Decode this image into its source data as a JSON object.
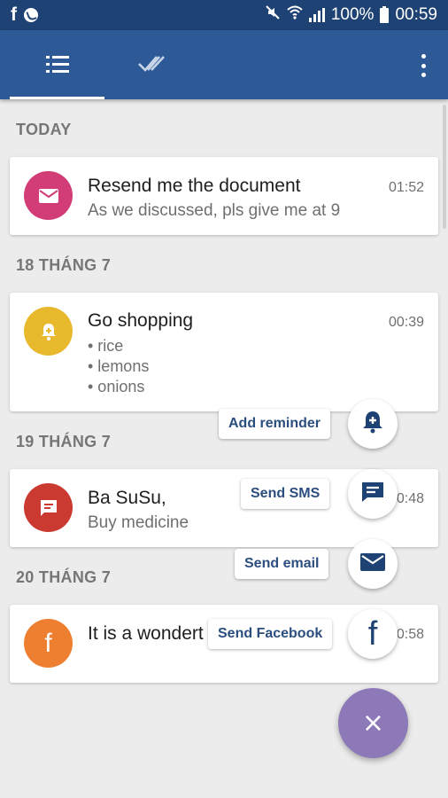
{
  "status_bar": {
    "left_icons": [
      "facebook-icon",
      "whatsapp-icon"
    ],
    "right_icons": [
      "mute-icon",
      "wifi-icon",
      "signal-icon",
      "battery-icon"
    ],
    "battery": "100%",
    "time": "00:59"
  },
  "app_bar": {
    "tabs": [
      {
        "icon": "list-icon",
        "selected": true
      },
      {
        "icon": "done-all-icon",
        "selected": false
      }
    ],
    "menu_icon": "more-vert-icon"
  },
  "sections": [
    {
      "header": "TODAY",
      "items": [
        {
          "icon": "email-icon",
          "color": "#d23c77",
          "title": "Resend me the document",
          "subtitle": "As we discussed, pls give me at 9",
          "time": "01:52"
        }
      ]
    },
    {
      "header": "18 THÁNG 7",
      "items": [
        {
          "icon": "reminder-icon",
          "color": "#e8b92d",
          "title": "Go shopping",
          "bullets": [
            "• rice",
            "• lemons",
            "• onions"
          ],
          "time": "00:39"
        }
      ]
    },
    {
      "header": "19 THÁNG 7",
      "items": [
        {
          "icon": "sms-icon",
          "color": "#cb3a30",
          "title": "Ba SuSu,",
          "subtitle": "Buy medicine",
          "time": "0:48"
        }
      ]
    },
    {
      "header": "20 THÁNG 7",
      "items": [
        {
          "icon": "facebook-icon",
          "color": "#ee7f30",
          "title": "It is a wondert",
          "time": "0:58"
        }
      ]
    }
  ],
  "speed_dial": {
    "actions": [
      {
        "label": "Add reminder",
        "icon": "add-alert-icon"
      },
      {
        "label": "Send SMS",
        "icon": "message-icon"
      },
      {
        "label": "Send email",
        "icon": "email-icon"
      },
      {
        "label": "Send Facebook",
        "icon": "facebook-icon"
      }
    ],
    "close_label": "×",
    "fab_color": "#8d78b8"
  },
  "colors": {
    "status_bar": "#1f4275",
    "app_bar": "#2d5a97",
    "background": "#ececec"
  }
}
